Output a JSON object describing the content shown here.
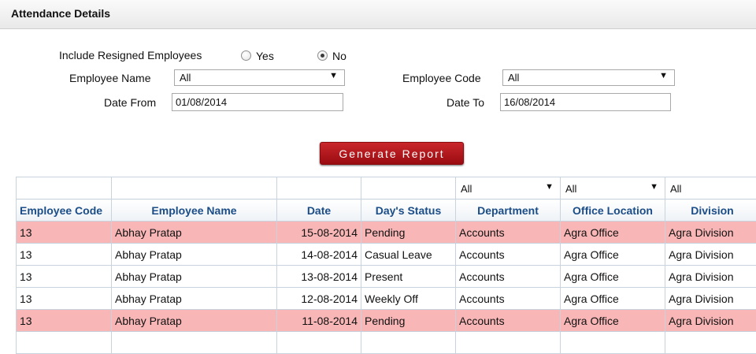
{
  "panel": {
    "title": "Attendance Details"
  },
  "filters": {
    "resigned_label": "Include Resigned Employees",
    "yes_label": "Yes",
    "no_label": "No",
    "resigned_selected": "No",
    "employee_name_label": "Employee Name",
    "employee_name_value": "All",
    "employee_code_label": "Employee Code",
    "employee_code_value": "All",
    "date_from_label": "Date From",
    "date_from_value": "01/08/2014",
    "date_to_label": "Date To",
    "date_to_value": "16/08/2014"
  },
  "actions": {
    "generate_label": "Generate Report"
  },
  "table": {
    "column_filters": {
      "department": "All",
      "office_location": "All",
      "division": "All"
    },
    "headers": [
      "Employee Code",
      "Employee Name",
      "Date",
      "Day's Status",
      "Department",
      "Office Location",
      "Division"
    ],
    "rows": [
      {
        "code": "13",
        "name": "Abhay Pratap",
        "date": "15-08-2014",
        "status": "Pending",
        "dept": "Accounts",
        "office": "Agra Office",
        "division": "Agra Division"
      },
      {
        "code": "13",
        "name": "Abhay Pratap",
        "date": "14-08-2014",
        "status": "Casual Leave",
        "dept": "Accounts",
        "office": "Agra Office",
        "division": "Agra Division"
      },
      {
        "code": "13",
        "name": "Abhay Pratap",
        "date": "13-08-2014",
        "status": "Present",
        "dept": "Accounts",
        "office": "Agra Office",
        "division": "Agra Division"
      },
      {
        "code": "13",
        "name": "Abhay Pratap",
        "date": "12-08-2014",
        "status": "Weekly Off",
        "dept": "Accounts",
        "office": "Agra Office",
        "division": "Agra Division"
      },
      {
        "code": "13",
        "name": "Abhay Pratap",
        "date": "11-08-2014",
        "status": "Pending",
        "dept": "Accounts",
        "office": "Agra Office",
        "division": "Agra Division"
      }
    ]
  },
  "colors": {
    "pending_row": "#f8b6b6",
    "header_text": "#1b4d88",
    "button": "#b51b20"
  },
  "icons": {
    "dropdown": "chevron-down-icon"
  }
}
